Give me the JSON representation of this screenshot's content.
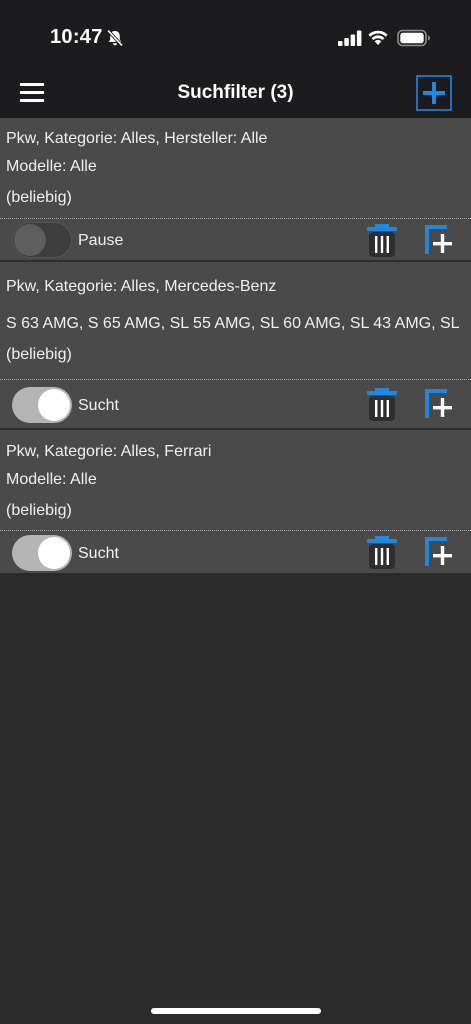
{
  "status_bar": {
    "time": "10:47"
  },
  "navbar": {
    "title": "Suchfilter (3)"
  },
  "colors": {
    "accent": "#1e88e5",
    "card_background": "#4a4a4a",
    "page_background": "#2b2b2b",
    "bar_background": "#1c1c1e"
  },
  "icons": {
    "menu": "hamburger-menu-icon",
    "add": "plus-square-icon",
    "delete": "trash-icon",
    "copy": "copy-add-icon",
    "mute": "bell-slash-icon"
  },
  "filters": [
    {
      "line1": "Pkw, Kategorie: Alles, Hersteller: Alle",
      "line2": "Modelle: Alle",
      "line3": "(beliebig)",
      "status": "Pause",
      "active": false
    },
    {
      "line1": "Pkw, Kategorie: Alles, Mercedes-Benz",
      "line2": "S 63 AMG, S 65 AMG, SL 55 AMG, SL 60 AMG, SL 43 AMG, SL",
      "line3": "(beliebig)",
      "status": "Sucht",
      "active": true
    },
    {
      "line1": "Pkw, Kategorie: Alles, Ferrari",
      "line2": "Modelle: Alle",
      "line3": "(beliebig)",
      "status": "Sucht",
      "active": true
    }
  ]
}
